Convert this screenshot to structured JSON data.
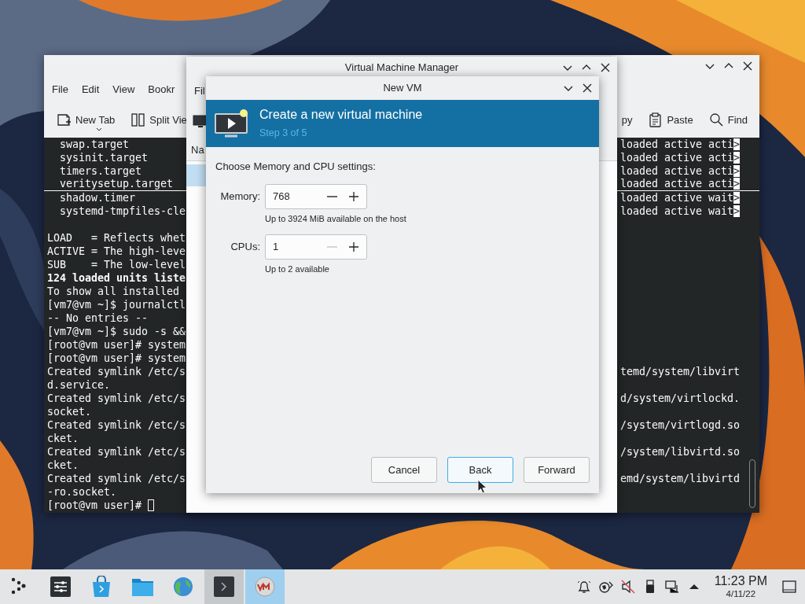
{
  "terminal_window": {
    "menu": [
      "File",
      "Edit",
      "View",
      "Bookr"
    ],
    "toolbar_left": [
      {
        "label": "New Tab",
        "kind": "new-tab"
      },
      {
        "label": "Split Vie",
        "kind": "split"
      }
    ],
    "toolbar_right": [
      {
        "label": "py",
        "kind": "none"
      },
      {
        "label": "Paste",
        "kind": "paste"
      },
      {
        "label": "Find",
        "kind": "find"
      }
    ],
    "lines": [
      {
        "left": "  swap.target",
        "right": "loaded active acti>",
        "highlight_last": true
      },
      {
        "left": "  sysinit.target",
        "right": "loaded active acti>",
        "highlight_last": true
      },
      {
        "left": "  timers.target",
        "right": "loaded active acti>",
        "highlight_last": true
      },
      {
        "left": "  veritysetup.target",
        "right": "loaded active acti>",
        "highlight_last": true,
        "underlined": true
      },
      {
        "left": "  shadow.timer",
        "right": "loaded active wait>",
        "highlight_last": true
      },
      {
        "left": "  systemd-tmpfiles-cle",
        "right": "loaded active wait>",
        "highlight_last": true
      },
      {
        "left": "LOAD   = Reflects whet",
        "gap_before": true
      },
      {
        "left": "ACTIVE = The high-leve"
      },
      {
        "left": "SUB    = The low-level"
      },
      {
        "left": "124 loaded units liste",
        "bold": true
      },
      {
        "left": "To show all installed"
      },
      {
        "left": "[vm7@vm ~]$ journalctl"
      },
      {
        "left": "-- No entries --"
      },
      {
        "left": "[vm7@vm ~]$ sudo -s &&"
      },
      {
        "left": "[root@vm user]# system"
      },
      {
        "left": "[root@vm user]# system"
      },
      {
        "left": "Created symlink /etc/s",
        "right": "temd/system/libvirt"
      },
      {
        "left": "d.service."
      },
      {
        "left": "Created symlink /etc/s",
        "right": "d/system/virtlockd."
      },
      {
        "left": "socket."
      },
      {
        "left": "Created symlink /etc/s",
        "right": "/system/virtlogd.so"
      },
      {
        "left": "cket."
      },
      {
        "left": "Created symlink /etc/s",
        "right": "/system/libvirtd.so"
      },
      {
        "left": "cket."
      },
      {
        "left": "Created symlink /etc/s",
        "right": "emd/system/libvirtd"
      },
      {
        "left": "-ro.socket."
      },
      {
        "left": "[root@vm user]# ",
        "cursor": true
      }
    ]
  },
  "manager_window": {
    "title": "Virtual Machine Manager",
    "menu": [
      "Fil"
    ],
    "column_header": "Na",
    "rows": [
      {
        "selected": true
      }
    ]
  },
  "dialog": {
    "title": "New VM",
    "heading": "Create a new virtual machine",
    "step": "Step 3 of 5",
    "prompt": "Choose Memory and CPU settings:",
    "fields": [
      {
        "label": "Memory:",
        "value": "768",
        "hint": "Up to 3924 MiB available on the host",
        "decrement_disabled": false
      },
      {
        "label": "CPUs:",
        "value": "1",
        "hint": "Up to 2 available",
        "decrement_disabled": true
      }
    ],
    "buttons": [
      {
        "label": "Cancel",
        "focused": false
      },
      {
        "label": "Back",
        "focused": true
      },
      {
        "label": "Forward",
        "focused": false
      }
    ]
  },
  "taskbar": {
    "tasks": [
      {
        "kind": "app-menu",
        "running": false,
        "selected": false
      },
      {
        "kind": "settings",
        "running": false,
        "selected": false
      },
      {
        "kind": "store",
        "running": false,
        "selected": false
      },
      {
        "kind": "folder",
        "running": false,
        "selected": false
      },
      {
        "kind": "globe",
        "running": false,
        "selected": false
      },
      {
        "kind": "terminal",
        "running": true,
        "selected": false
      },
      {
        "kind": "vm",
        "running": true,
        "selected": true
      }
    ],
    "clock": {
      "time": "11:23 PM",
      "date": "4/11/22"
    }
  }
}
